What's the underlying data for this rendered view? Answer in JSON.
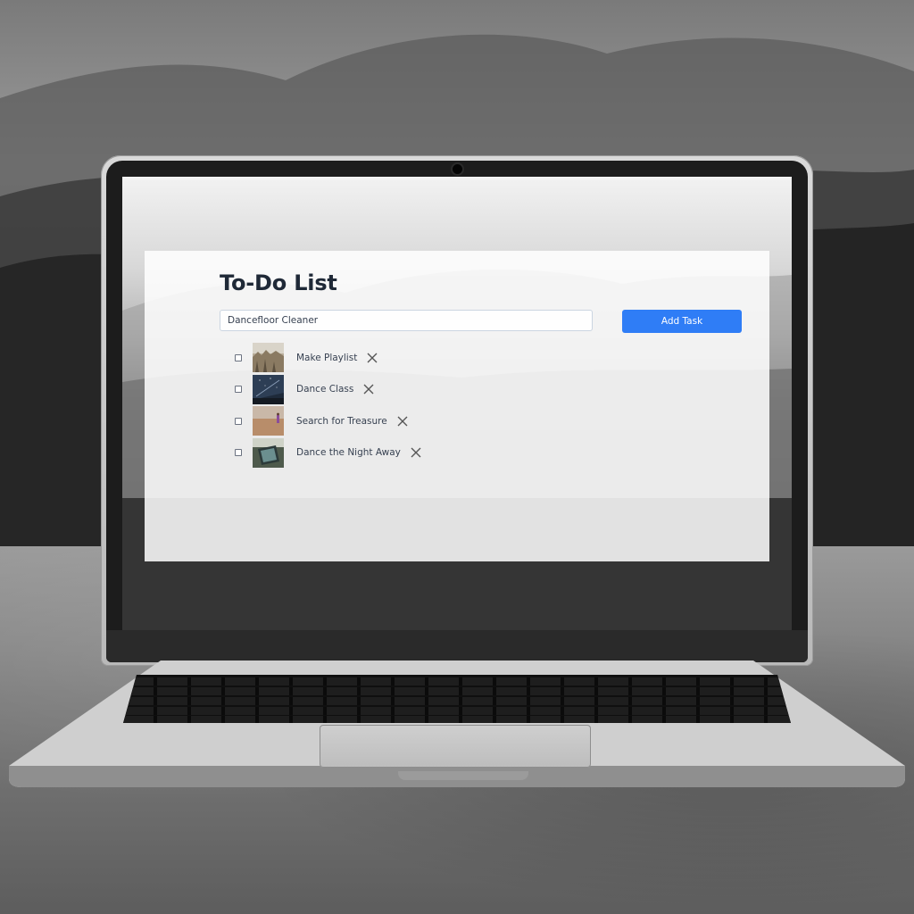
{
  "app": {
    "title": "To-Do List",
    "input": {
      "value": "Dancefloor Cleaner",
      "placeholder": ""
    },
    "add_button_label": "Add Task",
    "accent_color": "#2f7df6"
  },
  "tasks": [
    {
      "label": "Make Playlist",
      "checked": false,
      "thumbnail": "desert-canyon-photo"
    },
    {
      "label": "Dance Class",
      "checked": false,
      "thumbnail": "night-sky-photo"
    },
    {
      "label": "Search for Treasure",
      "checked": false,
      "thumbnail": "desert-figure-photo"
    },
    {
      "label": "Dance the Night Away",
      "checked": false,
      "thumbnail": "tablet-device-photo"
    }
  ],
  "icons": {
    "delete": "close-icon",
    "webcam": "camera-icon"
  }
}
